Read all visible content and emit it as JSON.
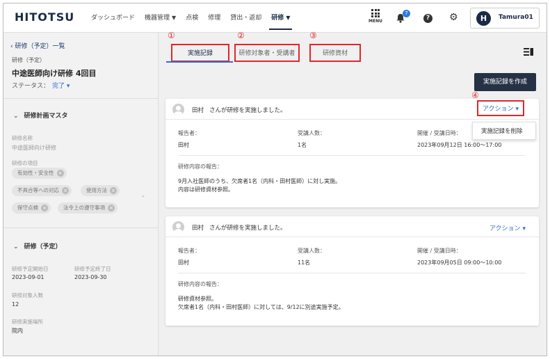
{
  "header": {
    "logo": "HITOTSU",
    "nav": [
      {
        "label": "ダッシュボード"
      },
      {
        "label": "機器管理",
        "dropdown": true
      },
      {
        "label": "点検"
      },
      {
        "label": "修理"
      },
      {
        "label": "貸出・返却"
      },
      {
        "label": "研修",
        "dropdown": true,
        "active": true
      }
    ],
    "menu_label": "MENU",
    "notification_count": "7",
    "help_glyph": "?",
    "user": {
      "initial": "H",
      "name": "Tamura01"
    }
  },
  "sidebar": {
    "back_link": "研修（予定）一覧",
    "breadcrumb_label": "研修（予定）",
    "title": "中途医師向け研修 4回目",
    "status_label": "ステータス：",
    "status_value": "完了",
    "master_section": {
      "heading": "研修計画マスタ",
      "name_label": "研修名称",
      "name_value": "中途医師向け研修",
      "items_label": "研修の項目",
      "items": [
        "有効性・安全性",
        "不具合等への対応",
        "使用方法",
        "保守点検",
        "法令上の遵守事項"
      ]
    },
    "plan_section": {
      "heading": "研修（予定）",
      "start_label": "研修予定開始日",
      "start_value": "2023-09-01",
      "end_label": "研修予定終了日",
      "end_value": "2023-09-30",
      "count_label": "研修対象人数",
      "count_value": "12",
      "place_label": "研修実施場所",
      "place_value": "院内"
    }
  },
  "tabs": [
    {
      "label": "実施記録",
      "annotation": "①",
      "active": true
    },
    {
      "label": "研修対象者・受講者",
      "annotation": "②"
    },
    {
      "label": "研修資材",
      "annotation": "③"
    }
  ],
  "create_button": "実施記録を作成",
  "action_annotation": "④",
  "action_menu": {
    "delete_label": "実施記録を削除"
  },
  "records": [
    {
      "header_name": "田村",
      "header_text": "さんが研修を実施しました。",
      "action_label": "アクション",
      "reporter_label": "報告者：",
      "reporter_value": "田村",
      "attendees_label": "受講人数：",
      "attendees_value": "1名",
      "datetime_label": "開催 / 受講日時：",
      "datetime_value": "2023年09月12日 16:00～17:00",
      "report_label": "研修内容の報告：",
      "report_lines": [
        "9月入社医師のうち、欠席者1名（内科・田村医師）に対し実施。",
        "内容は研修資材参照。"
      ]
    },
    {
      "header_name": "田村",
      "header_text": "さんが研修を実施しました。",
      "action_label": "アクション",
      "reporter_label": "報告者：",
      "reporter_value": "田村",
      "attendees_label": "受講人数：",
      "attendees_value": "11名",
      "datetime_label": "開催 / 受講日時：",
      "datetime_value": "2023年09月05日 09:00～10:00",
      "report_label": "研修内容の報告：",
      "report_lines": [
        "研修資材参照。",
        "欠席者1名（内科・田村医師）に対しては、9/12に別途実施予定。"
      ]
    }
  ]
}
